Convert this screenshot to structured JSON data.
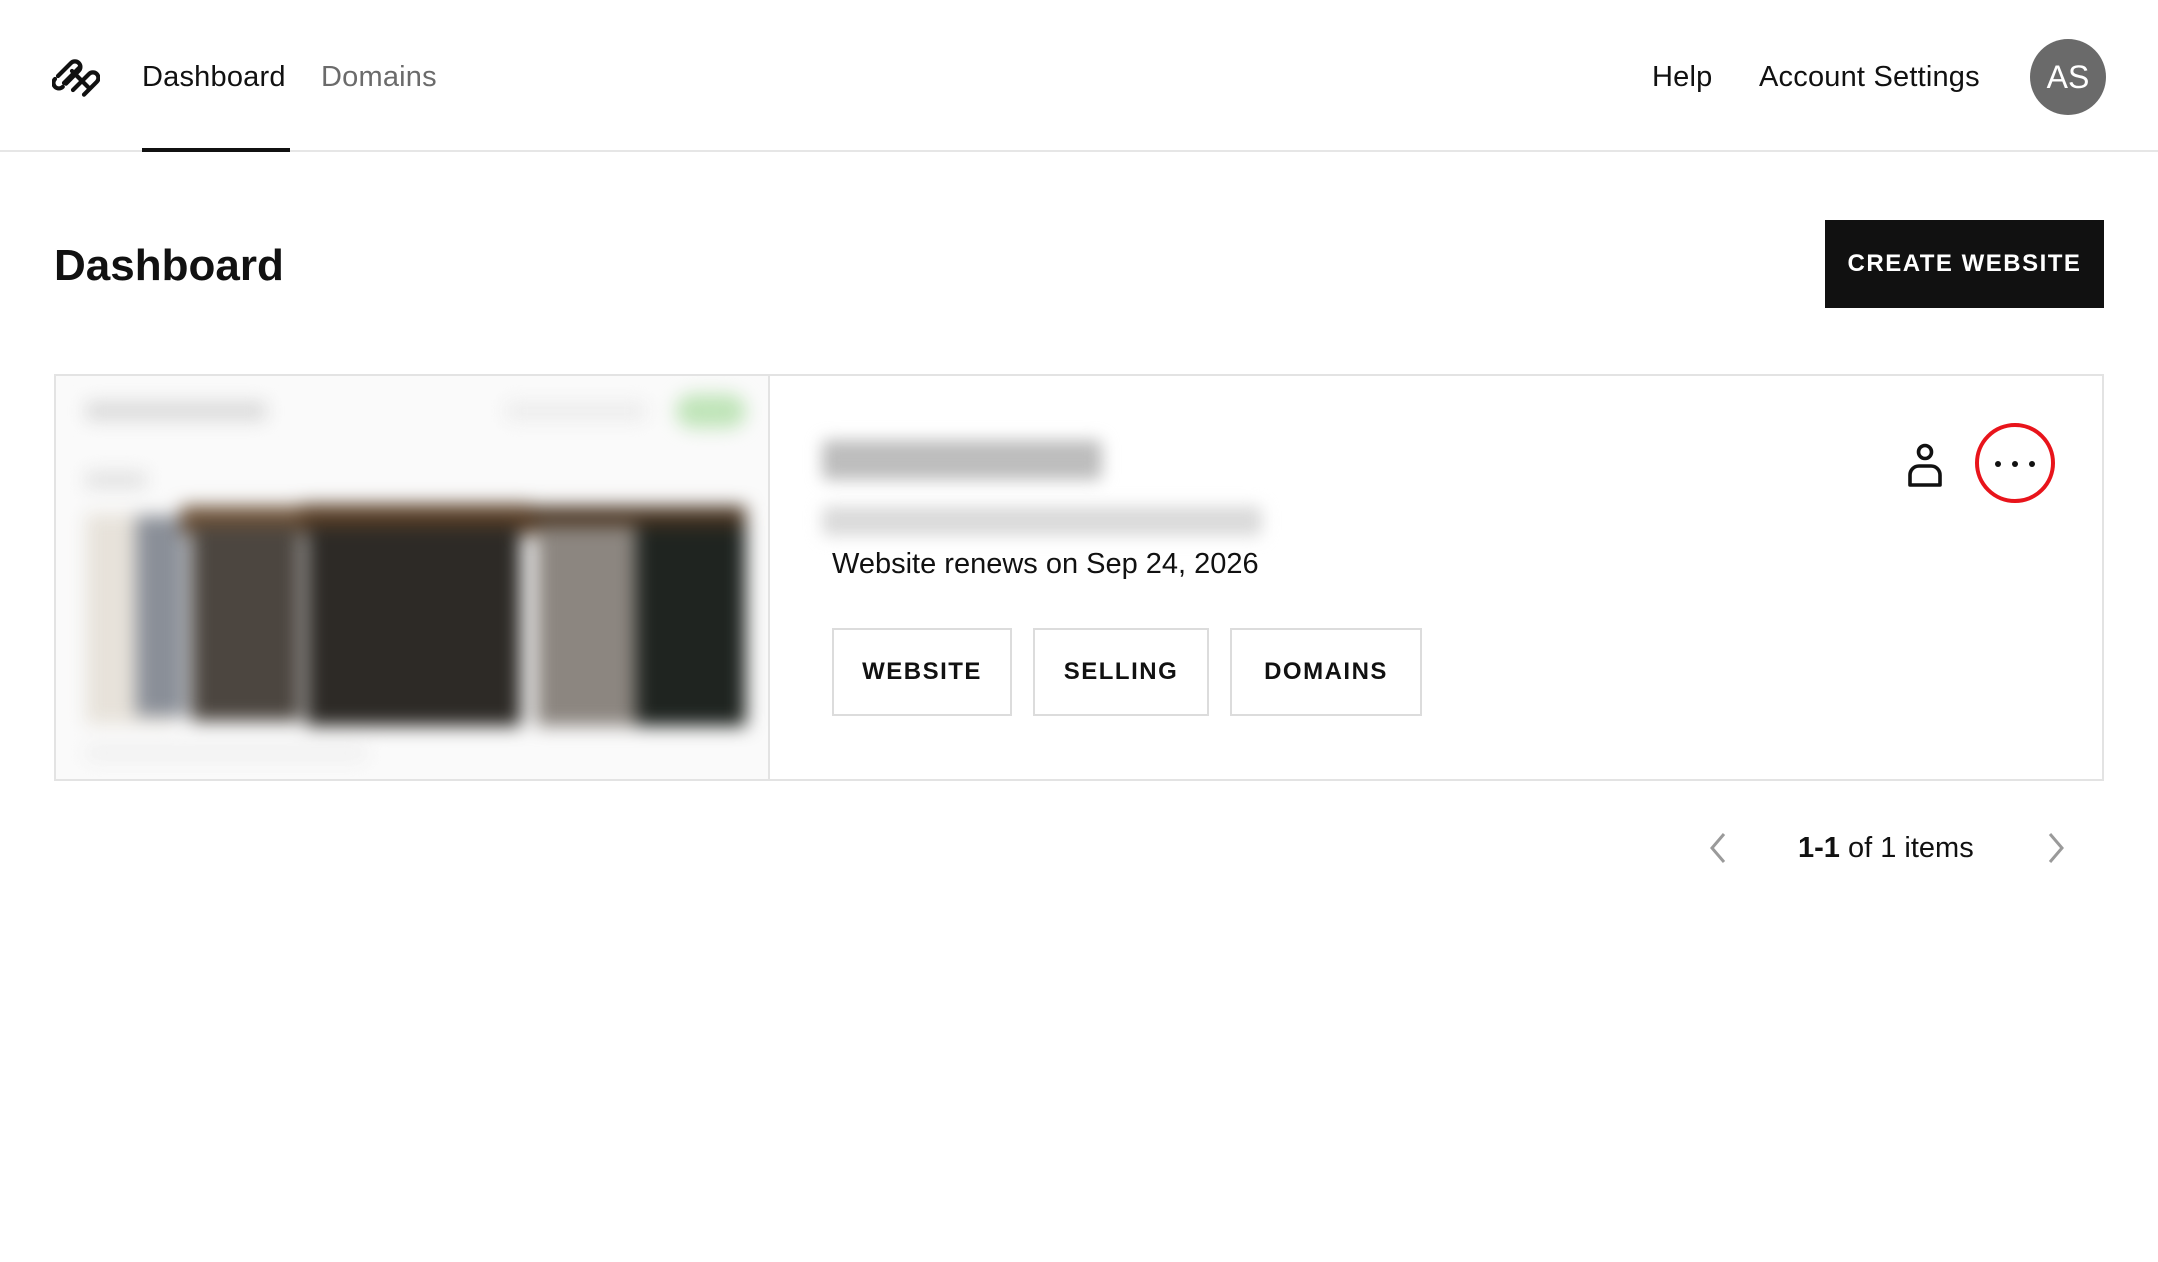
{
  "nav": {
    "dashboard": "Dashboard",
    "domains": "Domains",
    "help": "Help",
    "account_settings": "Account Settings",
    "avatar_initials": "AS"
  },
  "page": {
    "title": "Dashboard",
    "create_button": "CREATE WEBSITE"
  },
  "site_card": {
    "renewal": "Website renews on Sep 24, 2026",
    "buttons": [
      "WEBSITE",
      "SELLING",
      "DOMAINS"
    ],
    "icons": [
      "person-icon",
      "more-options-icon"
    ],
    "highlight_color": "#e8141b"
  },
  "pagination": {
    "range": "1-1",
    "suffix": " of 1 items"
  }
}
